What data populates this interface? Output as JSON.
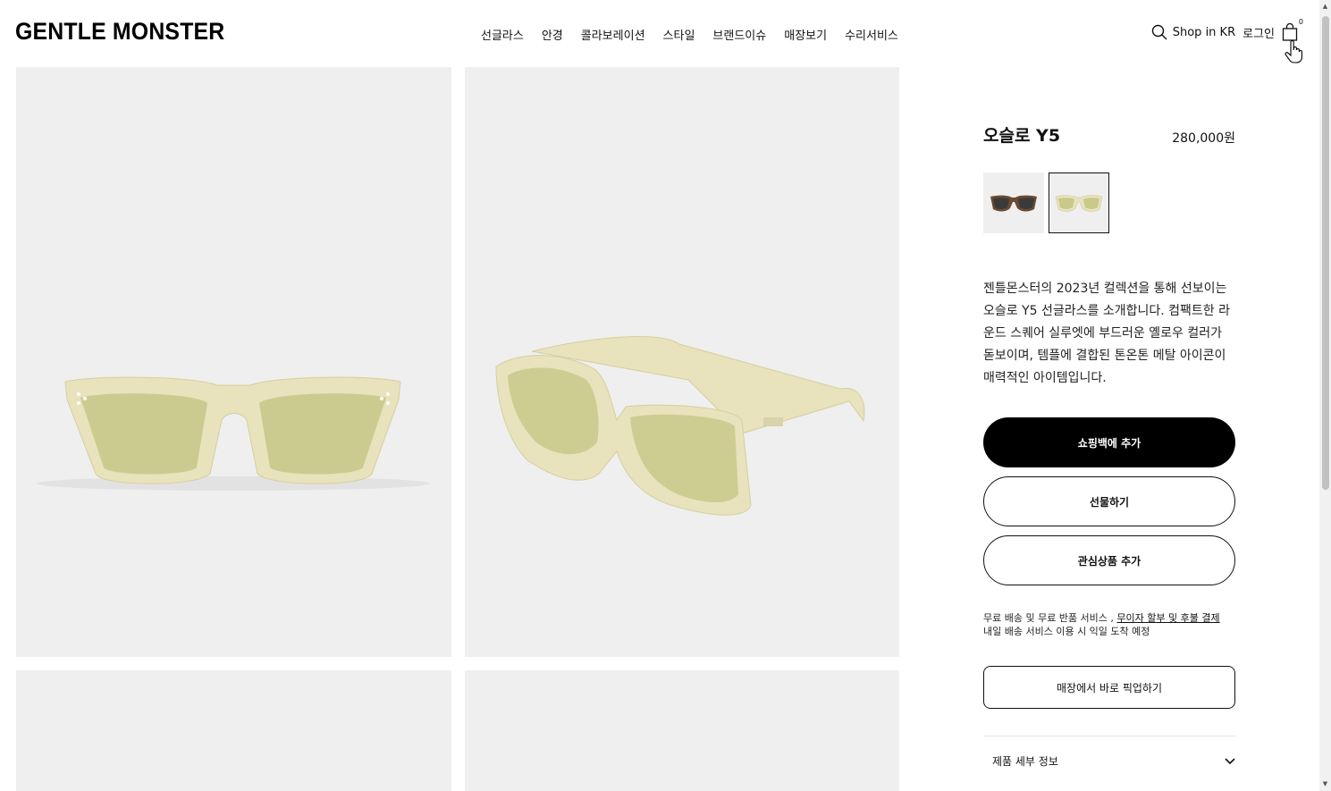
{
  "header": {
    "logo": "GENTLE MONSTER",
    "nav": [
      "선글라스",
      "안경",
      "콜라보레이션",
      "스타일",
      "브랜드이슈",
      "매장보기",
      "수리서비스"
    ],
    "shop_region": "Shop in KR",
    "login": "로그인",
    "cart_count": "0"
  },
  "product": {
    "name": "오슬로 Y5",
    "price": "280,000원",
    "swatches": [
      "black-tortoise",
      "yellow"
    ],
    "selected_swatch": 1,
    "description": "젠틀몬스터의 2023년 컬렉션을 통해 선보이는 오슬로 Y5 선글라스를 소개합니다. 컴팩트한 라운드 스퀘어 실루엣에 부드러운 옐로우 컬러가 돋보이며, 템플에 결합된 톤온톤 메탈 아이콘이 매력적인 아이템입니다.",
    "add_to_bag": "쇼핑백에 추가",
    "gift": "선물하기",
    "wishlist": "관심상품 추가",
    "shipping_line1": "무료 배송 및 무료 반품 서비스 ,",
    "shipping_link": "무이자 할부 및 후불 결제",
    "shipping_line2": "내일 배송 서비스 이용 시 익일 도착 예정",
    "pickup": "매장에서 바로 픽업하기",
    "details": "제품 세부 정보"
  },
  "colors": {
    "frame": "#e8e2bd",
    "lens": "#c9c98a",
    "tile_bg": "#efefef"
  }
}
